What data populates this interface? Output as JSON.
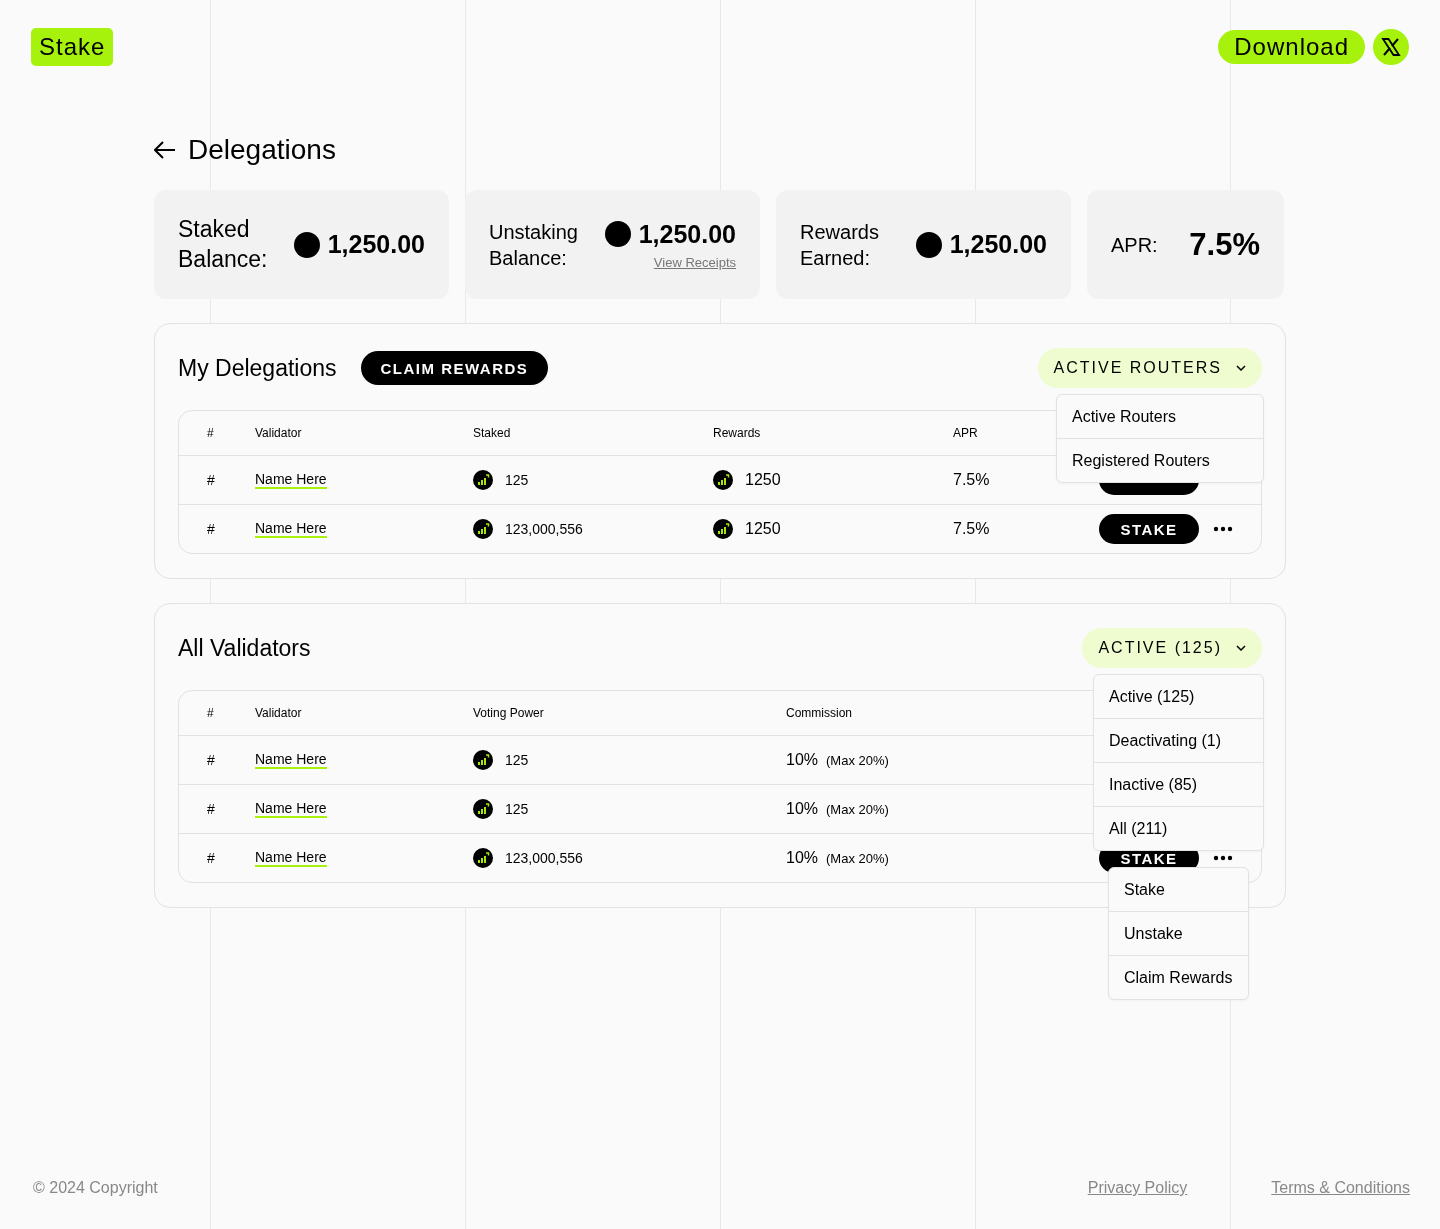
{
  "header": {
    "logo": "Stake",
    "download_button": "Download"
  },
  "page_title": "Delegations",
  "stats": [
    {
      "kind": "balance",
      "label": "Staked Balance:",
      "value": "1,250.00"
    },
    {
      "kind": "balance",
      "label": "Unstaking Balance:",
      "value": "1,250.00",
      "link": "View Receipts"
    },
    {
      "kind": "balance",
      "label": "Rewards Earned:",
      "value": "1,250.00"
    },
    {
      "kind": "rate",
      "label": "APR:",
      "value": "7.5%"
    }
  ],
  "delegations": {
    "title": "My Delegations",
    "claim_button": "CLAIM REWARDS",
    "filter": {
      "label": "ACTIVE ROUTERS",
      "options": [
        "Active Routers",
        "Registered Routers"
      ]
    },
    "columns": [
      "#",
      "Validator",
      "Staked",
      "Rewards",
      "APR"
    ],
    "rows": [
      {
        "index": "#",
        "validator": "Name Here",
        "staked": "125",
        "rewards": "1250",
        "apr": "7.5%",
        "stake": true,
        "menu": false
      },
      {
        "index": "#",
        "validator": "Name Here",
        "staked": "123,000,556",
        "rewards": "1250",
        "apr": "7.5%",
        "stake": true,
        "stake_label": "STAKE",
        "menu": true
      }
    ]
  },
  "validators": {
    "title": "All Validators",
    "filter": {
      "label": "ACTIVE (125)",
      "options": [
        "Active (125)",
        "Deactivating (1)",
        "Inactive (85)",
        "All (211)"
      ]
    },
    "columns": [
      "#",
      "Validator",
      "Voting Power",
      "Commission"
    ],
    "rows": [
      {
        "index": "#",
        "validator": "Name Here",
        "voting_power": "125",
        "commission": "10%",
        "commission_max": "(Max 20%)",
        "stake": false,
        "menu": false
      },
      {
        "index": "#",
        "validator": "Name Here",
        "voting_power": "125",
        "commission": "10%",
        "commission_max": "(Max 20%)",
        "stake": false,
        "menu": false
      },
      {
        "index": "#",
        "validator": "Name Here",
        "voting_power": "123,000,556",
        "commission": "10%",
        "commission_max": "(Max 20%)",
        "stake": true,
        "stake_label": "STAKE",
        "menu": true
      }
    ],
    "action_menu": [
      "Stake",
      "Unstake",
      "Claim Rewards"
    ]
  },
  "footer": {
    "copyright": "© 2024 Copyright",
    "links": [
      "Privacy Policy",
      "Terms & Conditions"
    ]
  }
}
